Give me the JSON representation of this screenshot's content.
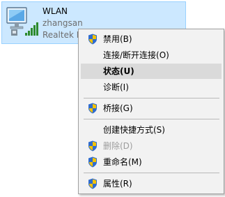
{
  "adapter": {
    "name": "WLAN",
    "user": "zhangsan",
    "device": "Realtek R"
  },
  "menu": {
    "items": [
      {
        "label": "禁用(B)",
        "shield": true
      },
      {
        "label": "连接/断开连接(O)",
        "shield": false
      },
      {
        "label": "状态(U)",
        "shield": false,
        "highlighted": true,
        "bold": true
      },
      {
        "label": "诊断(I)",
        "shield": false
      },
      {
        "label": "桥接(G)",
        "shield": true
      },
      {
        "label": "创建快捷方式(S)",
        "shield": false
      },
      {
        "label": "删除(D)",
        "shield": true,
        "disabled": true
      },
      {
        "label": "重命名(M)",
        "shield": true
      },
      {
        "label": "属性(R)",
        "shield": true
      }
    ]
  },
  "colors": {
    "selection_bg": "#cce8ff",
    "selection_border": "#99d1ff",
    "menu_bg": "#f2f2f2",
    "menu_highlight": "#dadada",
    "disabled_text": "#9d9d9d",
    "shield_blue": "#2f6ccf",
    "shield_yellow": "#f3c300"
  },
  "icons": {
    "adapter": "wireless-network-adapter-icon",
    "shield": "uac-shield-icon"
  }
}
